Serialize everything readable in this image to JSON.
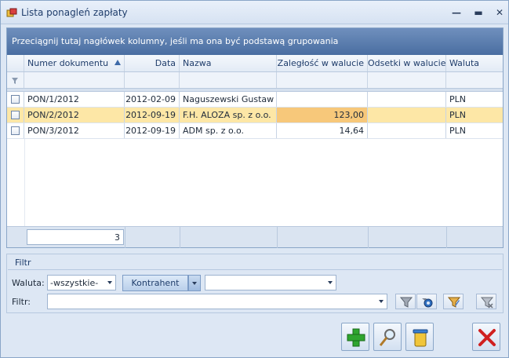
{
  "window": {
    "title": "Lista ponagleń zapłaty",
    "controls": [
      "minimize-icon",
      "maximize-icon",
      "close-icon"
    ]
  },
  "grid": {
    "group_hint": "Przeciągnij tutaj nagłówek kolumny, jeśli ma ona być podstawą grupowania",
    "columns": [
      {
        "key": "numer",
        "label": "Numer dokumentu",
        "sorted": "asc"
      },
      {
        "key": "data",
        "label": "Data"
      },
      {
        "key": "nazwa",
        "label": "Nazwa"
      },
      {
        "key": "zaleglosc",
        "label": "Zaległość w walucie"
      },
      {
        "key": "odsetki",
        "label": "Odsetki w walucie"
      },
      {
        "key": "waluta",
        "label": "Waluta"
      }
    ],
    "rows": [
      {
        "numer": "PON/1/2012",
        "data": "2012-02-09",
        "nazwa": "Naguszewski Gustaw",
        "zaleglosc": "",
        "odsetki": "",
        "waluta": "PLN",
        "selected": false
      },
      {
        "numer": "PON/2/2012",
        "data": "2012-09-19",
        "nazwa": "F.H. ALOZA sp. z o.o.",
        "zaleglosc": "123,00",
        "odsetki": "",
        "waluta": "PLN",
        "selected": true
      },
      {
        "numer": "PON/3/2012",
        "data": "2012-09-19",
        "nazwa": "ADM sp. z o.o.",
        "zaleglosc": "14,64",
        "odsetki": "",
        "waluta": "PLN",
        "selected": false
      }
    ],
    "footer_count": "3"
  },
  "filter": {
    "section_title": "Filtr",
    "waluta_label": "Waluta:",
    "waluta_value": "-wszystkie-",
    "kontrahent_button": "Kontrahent",
    "kontrahent_value": "",
    "filtr_label": "Filtr:",
    "filtr_value": ""
  },
  "colors": {
    "selection_row": "#fde7a6",
    "selection_cell": "#f7c87a",
    "group_bar": "#5a7db0"
  }
}
